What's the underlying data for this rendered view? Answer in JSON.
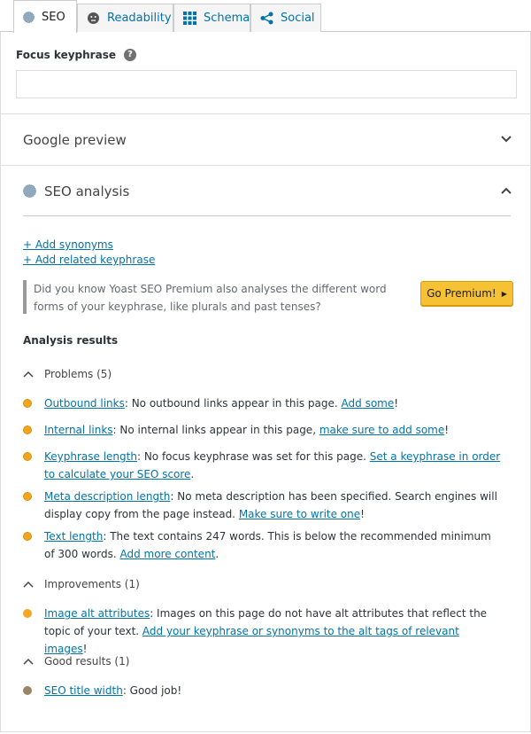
{
  "tabs": [
    {
      "label": "SEO",
      "icon": "seo-score-icon"
    },
    {
      "label": "Readability",
      "icon": "smiley-icon"
    },
    {
      "label": "Schema",
      "icon": "grid-icon"
    },
    {
      "label": "Social",
      "icon": "share-icon"
    }
  ],
  "focus": {
    "label": "Focus keyphrase",
    "value": "",
    "placeholder": ""
  },
  "google_preview": {
    "label": "Google preview"
  },
  "seo_analysis": {
    "label": "SEO analysis",
    "add_synonyms": "+ Add synonyms",
    "add_related": "+ Add related keyphrase",
    "premium_text": "Did you know Yoast SEO Premium also analyses the different word forms of your keyphrase, like plurals and past tenses?",
    "premium_button": "Go Premium!"
  },
  "results": {
    "heading": "Analysis results",
    "problems": {
      "label": "Problems (5)",
      "items": [
        {
          "link": "Outbound links",
          "text": ": No outbound links appear in this page. ",
          "action": "Add some",
          "end": "!"
        },
        {
          "link": "Internal links",
          "text": ": No internal links appear in this page, ",
          "action": "make sure to add some",
          "end": "!"
        },
        {
          "link": "Keyphrase length",
          "text": ": No focus keyphrase was set for this page. ",
          "action": "Set a keyphrase in order to calculate your SEO score",
          "end": "."
        },
        {
          "link": "Meta description length",
          "text": ": No meta description has been specified. Search engines will display copy from the page instead. ",
          "action": "Make sure to write one",
          "end": "!"
        },
        {
          "link": "Text length",
          "text": ": The text contains 247 words. This is below the recommended minimum of 300 words. ",
          "action": "Add more content",
          "end": "."
        }
      ]
    },
    "improvements": {
      "label": "Improvements (1)",
      "items": [
        {
          "link": "Image alt attributes",
          "text": ": Images on this page do not have alt attributes that reflect the topic of your text. ",
          "action": "Add your keyphrase or synonyms to the alt tags of relevant images",
          "end": "!"
        }
      ]
    },
    "good": {
      "label": "Good results (1)",
      "items": [
        {
          "link": "SEO title width",
          "text": ": Good job!",
          "action": "",
          "end": ""
        }
      ]
    }
  },
  "colors": {
    "link": "#0073aa",
    "problem": "#f0a51e",
    "improvement": "#f5a623",
    "good": "#9a8466",
    "premium": "#f7c136"
  }
}
